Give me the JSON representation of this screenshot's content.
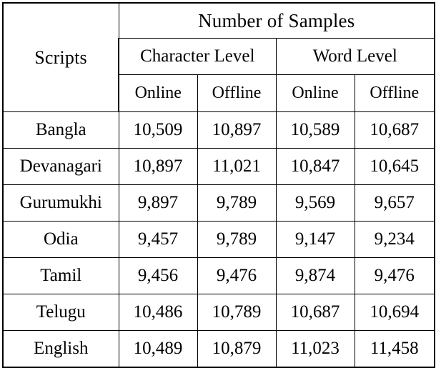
{
  "table": {
    "row_header_label": "Scripts",
    "group_header": "Number of Samples",
    "level_headers": [
      "Character Level",
      "Word Level"
    ],
    "sub_headers": [
      "Online",
      "Offline",
      "Online",
      "Offline"
    ],
    "rows": [
      {
        "script": "Bangla",
        "char_online": "10,509",
        "char_offline": "10,897",
        "word_online": "10,589",
        "word_offline": "10,687"
      },
      {
        "script": "Devanagari",
        "char_online": "10,897",
        "char_offline": "11,021",
        "word_online": "10,847",
        "word_offline": "10,645"
      },
      {
        "script": "Gurumukhi",
        "char_online": "9,897",
        "char_offline": "9,789",
        "word_online": "9,569",
        "word_offline": "9,657"
      },
      {
        "script": "Odia",
        "char_online": "9,457",
        "char_offline": "9,789",
        "word_online": "9,147",
        "word_offline": "9,234"
      },
      {
        "script": "Tamil",
        "char_online": "9,456",
        "char_offline": "9,476",
        "word_online": "9,874",
        "word_offline": "9,476"
      },
      {
        "script": "Telugu",
        "char_online": "10,486",
        "char_offline": "10,789",
        "word_online": "10,687",
        "word_offline": "10,694"
      },
      {
        "script": "English",
        "char_online": "10,489",
        "char_offline": "10,879",
        "word_online": "11,023",
        "word_offline": "11,458"
      }
    ]
  },
  "chart_data": {
    "type": "table",
    "title": "Number of Samples",
    "row_label": "Scripts",
    "column_groups": [
      {
        "name": "Character Level",
        "columns": [
          "Online",
          "Offline"
        ]
      },
      {
        "name": "Word Level",
        "columns": [
          "Online",
          "Offline"
        ]
      }
    ],
    "categories": [
      "Bangla",
      "Devanagari",
      "Gurumukhi",
      "Odia",
      "Tamil",
      "Telugu",
      "English"
    ],
    "series": [
      {
        "name": "Character Level - Online",
        "values": [
          10509,
          10897,
          9897,
          9457,
          9456,
          10486,
          10489
        ]
      },
      {
        "name": "Character Level - Offline",
        "values": [
          10897,
          11021,
          9789,
          9789,
          9476,
          10789,
          10879
        ]
      },
      {
        "name": "Word Level - Online",
        "values": [
          10589,
          10847,
          9569,
          9147,
          9874,
          10687,
          11023
        ]
      },
      {
        "name": "Word Level - Offline",
        "values": [
          10687,
          10645,
          9657,
          9234,
          9476,
          10694,
          11458
        ]
      }
    ]
  }
}
